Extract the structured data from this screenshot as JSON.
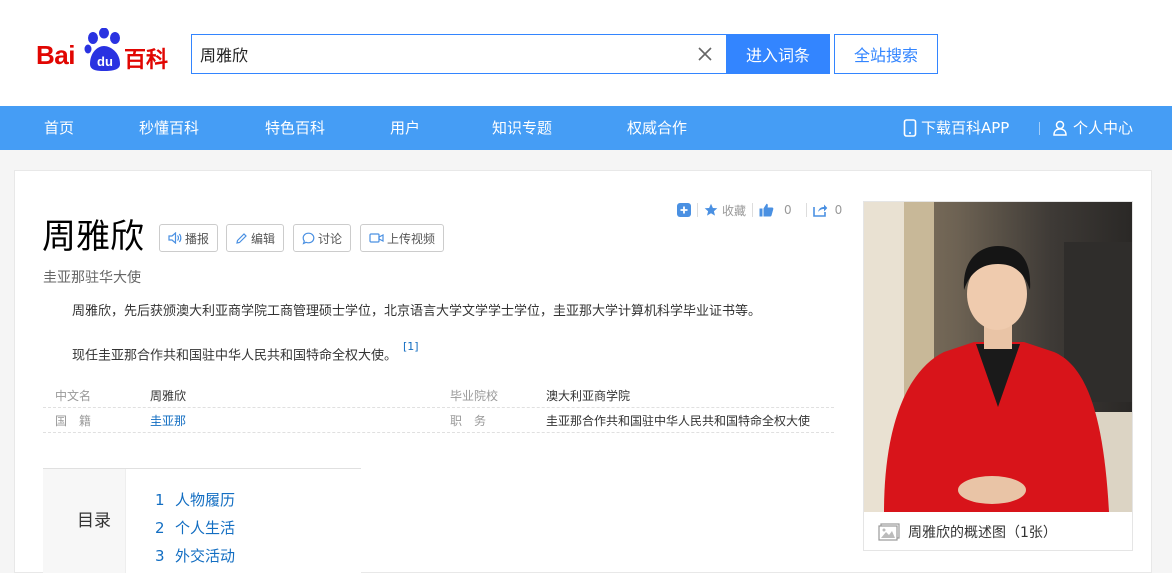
{
  "brand": {
    "logo_text_left": "Bai",
    "logo_text_paw": "du",
    "logo_text_right": "百科"
  },
  "search": {
    "value": "周雅欣",
    "enter_label": "进入词条",
    "site_label": "全站搜索"
  },
  "nav": {
    "items": [
      "首页",
      "秒懂百科",
      "特色百科",
      "用户",
      "知识专题",
      "权威合作"
    ],
    "download_app": "下载百科APP",
    "user_center": "个人中心"
  },
  "tools": {
    "favorite_label": "收藏",
    "like_count": "0",
    "share_count": "0"
  },
  "entry": {
    "title": "周雅欣",
    "actions": [
      "播报",
      "编辑",
      "讨论",
      "上传视频"
    ],
    "subtitle": "圭亚那驻华大使",
    "summary": [
      "周雅欣，先后获颁澳大利亚商学院工商管理硕士学位，北京语言大学文学学士学位，圭亚那大学计算机科学毕业证书等。",
      "现任圭亚那合作共和国驻中华人民共和国特命全权大使。"
    ],
    "ref_mark": "[1]"
  },
  "basic_info": [
    {
      "k1": "中文名",
      "v1": "周雅欣",
      "k2": "毕业院校",
      "v2": "澳大利亚商学院"
    },
    {
      "k1": "国　籍",
      "v1": "圭亚那",
      "k2": "职　务",
      "v2": "圭亚那合作共和国驻中华人民共和国特命全权大使"
    }
  ],
  "toc": {
    "title": "目录",
    "items": [
      {
        "num": "1",
        "label": "人物履历"
      },
      {
        "num": "2",
        "label": "个人生活"
      },
      {
        "num": "3",
        "label": "外交活动"
      }
    ]
  },
  "picture": {
    "caption": "周雅欣的概述图（1张）"
  },
  "colors": {
    "brand_red": "#e10602",
    "accent_blue": "#3385ff",
    "nav_blue": "#459df5",
    "link_blue": "#136ec2"
  }
}
